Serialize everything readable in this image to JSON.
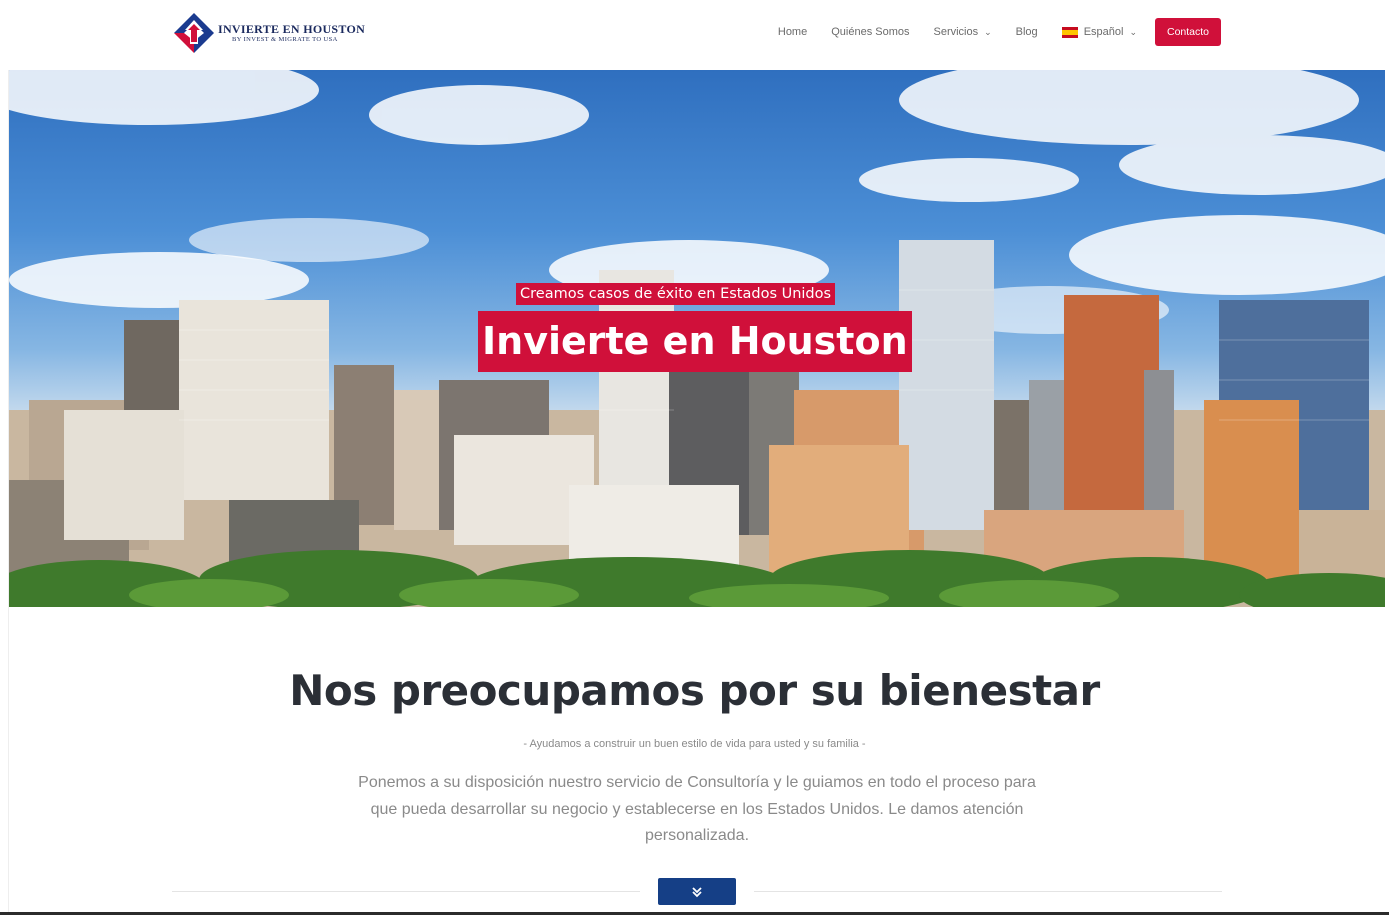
{
  "colors": {
    "accent": "#d0103a",
    "navy": "#153f86",
    "heading": "#2b2f36",
    "muted": "#8a8a8a"
  },
  "brand": {
    "name": "INVIERTE EN HOUSTON",
    "tagline": "BY INVEST & MIGRATE TO USA"
  },
  "nav": {
    "items": [
      {
        "label": "Home",
        "has_dropdown": false
      },
      {
        "label": "Quiénes Somos",
        "has_dropdown": false
      },
      {
        "label": "Servicios",
        "has_dropdown": true
      },
      {
        "label": "Blog",
        "has_dropdown": false
      }
    ],
    "language": {
      "label": "Español",
      "icon": "spain-flag-icon"
    },
    "contact_button": "Contacto"
  },
  "hero": {
    "subtitle": "Creamos casos de éxito en Estados Unidos",
    "title": "Invierte en Houston"
  },
  "intro": {
    "heading": "Nos preocupamos por su bienestar",
    "tagline": "- Ayudamos a construir un buen estilo de vida para usted y su familia -",
    "body": "Ponemos a su disposición nuestro servicio de Consultoría y le guiamos en todo el proceso para que pueda desarrollar su negocio y establecerse en los Estados Unidos. Le damos atención personalizada."
  },
  "scroll_button": {
    "icon": "double-chevron-down-icon"
  }
}
